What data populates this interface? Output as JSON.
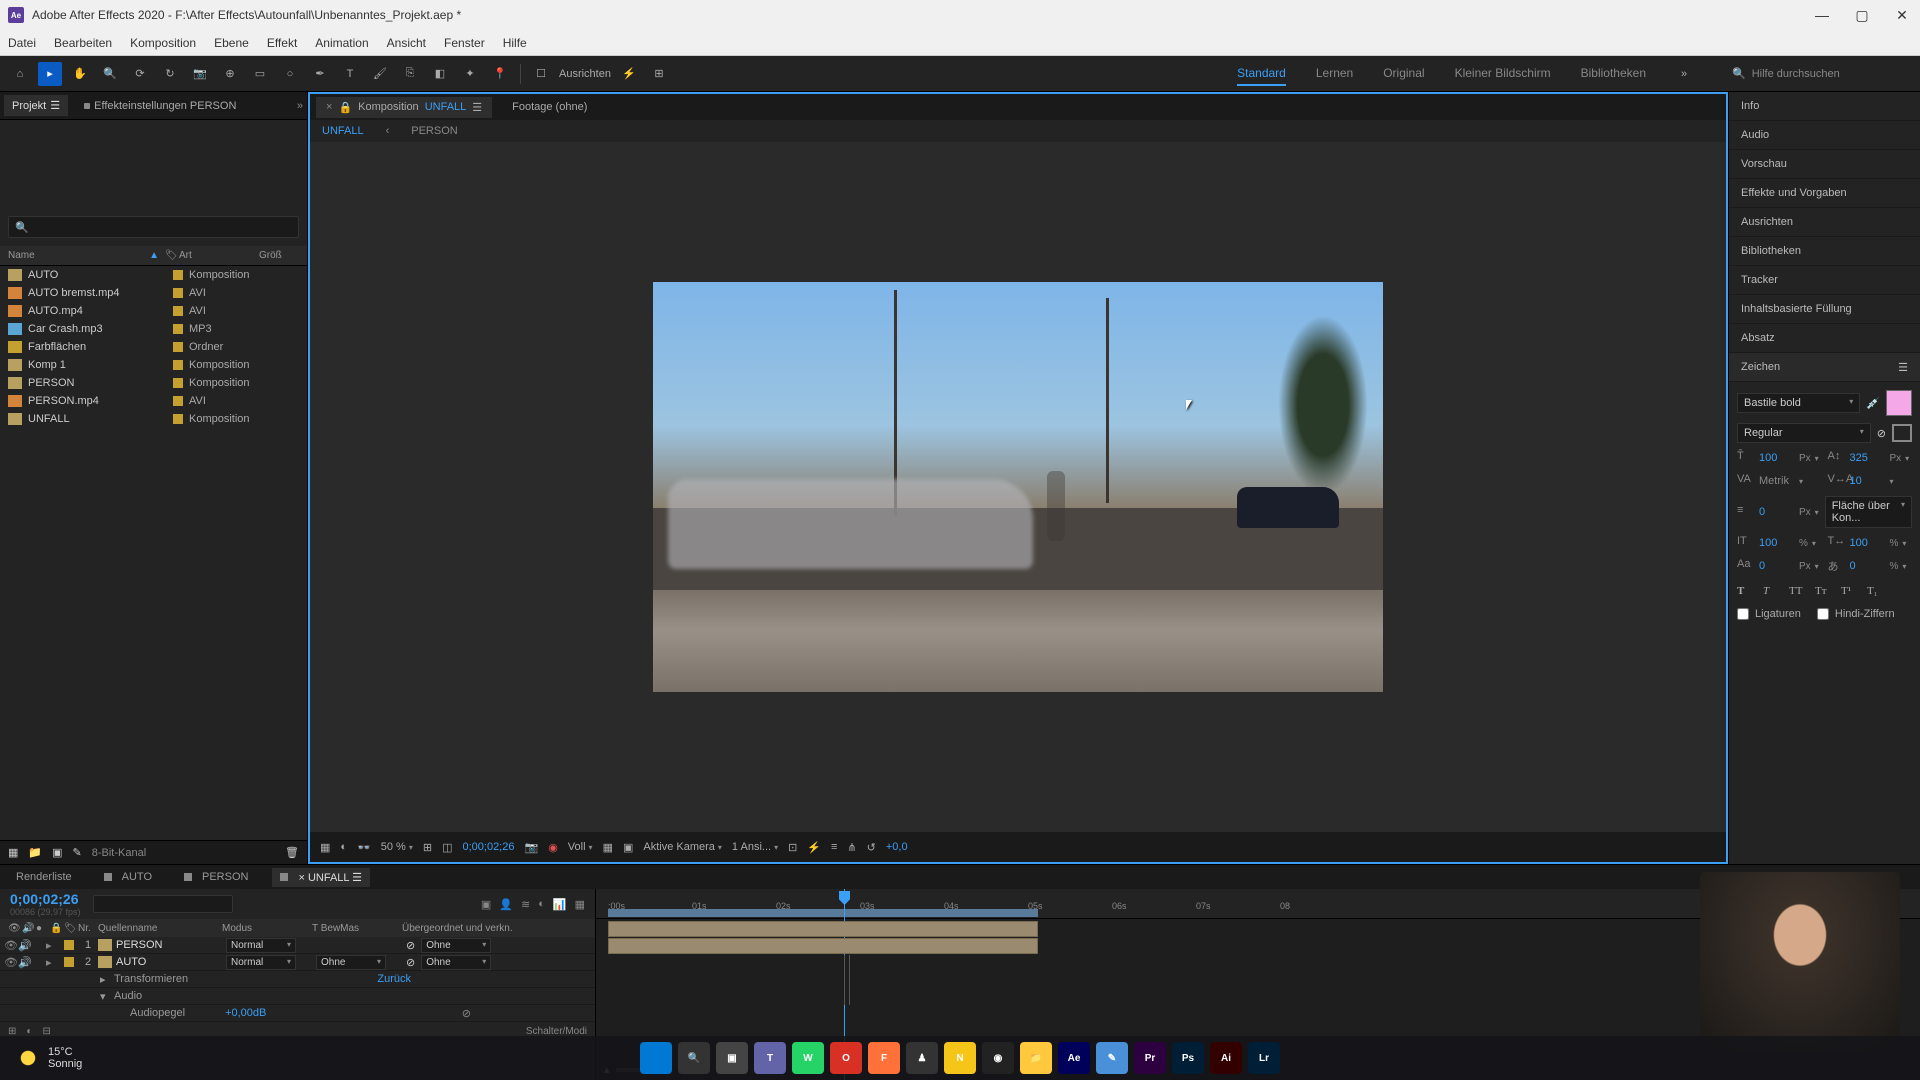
{
  "titlebar": {
    "title": "Adobe After Effects 2020 - F:\\After Effects\\Autounfall\\Unbenanntes_Projekt.aep *"
  },
  "menubar": [
    "Datei",
    "Bearbeiten",
    "Komposition",
    "Ebene",
    "Effekt",
    "Animation",
    "Ansicht",
    "Fenster",
    "Hilfe"
  ],
  "toolbar": {
    "align": "Ausrichten"
  },
  "workspaces": [
    "Standard",
    "Lernen",
    "Original",
    "Kleiner Bildschirm",
    "Bibliotheken"
  ],
  "search_placeholder": "Hilfe durchsuchen",
  "left_tabs": {
    "project": "Projekt",
    "effect": "Effekteinstellungen PERSON"
  },
  "proj_cols": {
    "name": "Name",
    "art": "Art",
    "size": "Größ"
  },
  "proj_items": [
    {
      "icon": "comp",
      "name": "AUTO",
      "art": "Komposition"
    },
    {
      "icon": "vid",
      "name": "AUTO bremst.mp4",
      "art": "AVI"
    },
    {
      "icon": "vid",
      "name": "AUTO.mp4",
      "art": "AVI"
    },
    {
      "icon": "aud",
      "name": "Car Crash.mp3",
      "art": "MP3"
    },
    {
      "icon": "folder",
      "name": "Farbflächen",
      "art": "Ordner"
    },
    {
      "icon": "comp",
      "name": "Komp 1",
      "art": "Komposition"
    },
    {
      "icon": "comp",
      "name": "PERSON",
      "art": "Komposition"
    },
    {
      "icon": "vid",
      "name": "PERSON.mp4",
      "art": "AVI"
    },
    {
      "icon": "comp",
      "name": "UNFALL",
      "art": "Komposition"
    }
  ],
  "proj_footer": {
    "bit": "8-Bit-Kanal"
  },
  "comp": {
    "label": "Komposition",
    "name": "UNFALL",
    "footage": "Footage (ohne)"
  },
  "comp_subtabs": [
    "UNFALL",
    "PERSON"
  ],
  "viewer": {
    "zoom": "50 %",
    "time": "0;00;02;26",
    "res": "Voll",
    "camera": "Aktive Kamera",
    "views": "1 Ansi...",
    "exposure": "+0,0"
  },
  "right_panels": [
    "Info",
    "Audio",
    "Vorschau",
    "Effekte und Vorgaben",
    "Ausrichten",
    "Bibliotheken",
    "Tracker",
    "Inhaltsbasierte Füllung",
    "Absatz",
    "Zeichen"
  ],
  "char": {
    "font": "Bastile bold",
    "style": "Regular",
    "size": "100",
    "size_u": "Px",
    "lead": "325",
    "lead_u": "Px",
    "kern": "Metrik",
    "track": "10",
    "stroke": "0",
    "stroke_u": "Px",
    "fill_label": "Fläche über Kon...",
    "vscale": "100",
    "vscale_u": "%",
    "hscale": "100",
    "hscale_u": "%",
    "baseline": "0",
    "baseline_u": "Px",
    "tsume": "0",
    "tsume_u": "%",
    "lig": "Ligaturen",
    "hindi": "Hindi-Ziffern"
  },
  "timeline": {
    "tabs": [
      "Renderliste",
      "AUTO",
      "PERSON",
      "UNFALL"
    ],
    "timecode": "0;00;02;26",
    "frames": "00086 (29,97 fps)",
    "cols": {
      "nr": "Nr.",
      "name": "Quellenname",
      "mode": "Modus",
      "trk": "T BewMas",
      "parent": "Übergeordnet und verkn."
    },
    "layers": [
      {
        "num": "1",
        "name": "PERSON",
        "mode": "Normal",
        "parent": "Ohne"
      },
      {
        "num": "2",
        "name": "AUTO",
        "mode": "Normal",
        "trk": "Ohne",
        "parent": "Ohne"
      }
    ],
    "sub_transform": "Transformieren",
    "sub_transform_val": "Zurück",
    "sub_audio": "Audio",
    "sub_audiopegel": "Audiopegel",
    "sub_audiopegel_val": "+0,00dB",
    "footer": "Schalter/Modi",
    "ticks": [
      ":00s",
      "01s",
      "02s",
      "03s",
      "04s",
      "05s",
      "06s",
      "07s",
      "08"
    ]
  },
  "weather": {
    "temp": "15°C",
    "cond": "Sonnig"
  },
  "taskbar": [
    {
      "bg": "#0078d4",
      "t": ""
    },
    {
      "bg": "#333",
      "t": "🔍"
    },
    {
      "bg": "#444",
      "t": "▣"
    },
    {
      "bg": "#6264a7",
      "t": "T"
    },
    {
      "bg": "#25d366",
      "t": "W"
    },
    {
      "bg": "#d93025",
      "t": "O"
    },
    {
      "bg": "#ff7139",
      "t": "F"
    },
    {
      "bg": "#333",
      "t": "♟"
    },
    {
      "bg": "#f5c518",
      "t": "N"
    },
    {
      "bg": "#222",
      "t": "◉"
    },
    {
      "bg": "#ffc83d",
      "t": "📁"
    },
    {
      "bg": "#00005b",
      "t": "Ae"
    },
    {
      "bg": "#4a90d9",
      "t": "✎"
    },
    {
      "bg": "#2d0040",
      "t": "Pr"
    },
    {
      "bg": "#001e36",
      "t": "Ps"
    },
    {
      "bg": "#330000",
      "t": "Ai"
    },
    {
      "bg": "#001e36",
      "t": "Lr"
    }
  ]
}
